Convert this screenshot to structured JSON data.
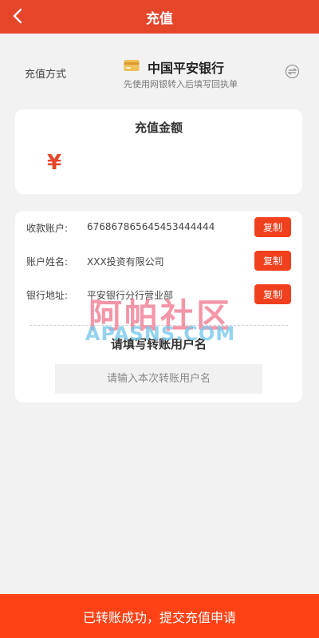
{
  "header": {
    "title": "充值",
    "back_icon": "chevron-left-icon"
  },
  "method": {
    "label": "充值方式",
    "bank_name": "中国平安银行",
    "hint": "先使用网银转入后填写回执单",
    "bank_icon": "bank-card-icon",
    "switch_icon": "swap-icon"
  },
  "amount": {
    "title": "充值金额",
    "currency_symbol": "¥",
    "value": "",
    "placeholder": ""
  },
  "account_info": {
    "rows": [
      {
        "label": "收款账户:",
        "value": "676867865645453444444",
        "copy_label": "复制"
      },
      {
        "label": "账户姓名:",
        "value": "XXX投资有限公司",
        "copy_label": "复制"
      },
      {
        "label": "银行地址:",
        "value": "平安银行分行营业部",
        "copy_label": "复制"
      }
    ]
  },
  "username": {
    "title": "请填写转账用户名",
    "placeholder": "请输入本次转账用户名",
    "value": ""
  },
  "watermark": {
    "cn": "阿帕社区",
    "en": "APASNS.COM"
  },
  "submit": {
    "label": "已转账成功，提交充值申请"
  },
  "colors": {
    "header": "#e5462a",
    "accent": "#f0401e",
    "submit": "#ff4216",
    "background": "#f2f2f2"
  }
}
